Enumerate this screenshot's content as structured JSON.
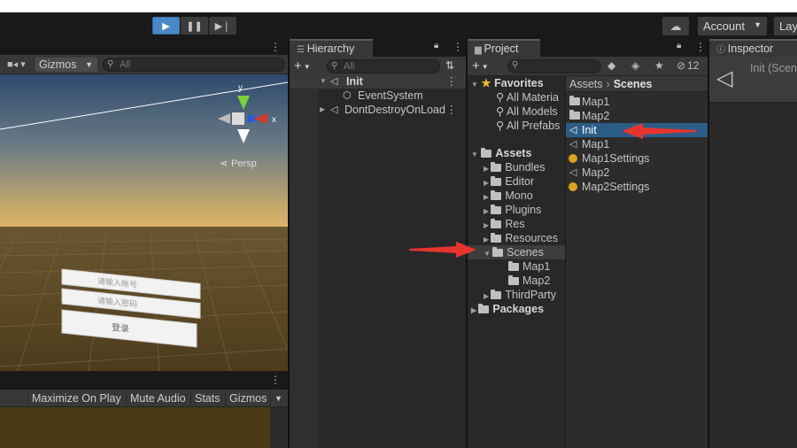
{
  "toolbar": {
    "account_label": "Account",
    "layout_label": "Lay"
  },
  "scene": {
    "gizmos_label": "Gizmos",
    "search_placeholder": "All",
    "persp_label": "Persp",
    "axis_y": "y",
    "axis_x": "x",
    "login_field_1": "请输入帐号",
    "login_field_2": "请输入密码",
    "login_button": "登录"
  },
  "game": {
    "maximize_label": "Maximize On Play",
    "mute_label": "Mute Audio",
    "stats_label": "Stats",
    "gizmos_label": "Gizmos"
  },
  "hierarchy": {
    "tab_label": "Hierarchy",
    "search_placeholder": "All",
    "items": [
      {
        "label": "Init"
      },
      {
        "label": "EventSystem"
      },
      {
        "label": "DontDestroyOnLoad"
      }
    ]
  },
  "project": {
    "tab_label": "Project",
    "hidden_count": "12",
    "favorites": {
      "label": "Favorites",
      "items": [
        "All Materia",
        "All Models",
        "All Prefabs"
      ]
    },
    "assets_label": "Assets",
    "folders": [
      "Bundles",
      "Editor",
      "Mono",
      "Plugins",
      "Res",
      "Resources",
      "Scenes",
      "ThirdParty"
    ],
    "scenes_children": [
      "Map1",
      "Map2"
    ],
    "packages_label": "Packages",
    "breadcrumb": {
      "root": "Assets",
      "current": "Scenes"
    },
    "files": [
      {
        "label": "Map1",
        "kind": "folder"
      },
      {
        "label": "Map2",
        "kind": "folder"
      },
      {
        "label": "Init",
        "kind": "scene"
      },
      {
        "label": "Map1",
        "kind": "scene"
      },
      {
        "label": "Map1Settings",
        "kind": "settings"
      },
      {
        "label": "Map2",
        "kind": "scene"
      },
      {
        "label": "Map2Settings",
        "kind": "settings"
      }
    ]
  },
  "inspector": {
    "tab_label": "Inspector",
    "title": "Init (Scen"
  },
  "colors": {
    "selection": "#2c5d87",
    "annotation_arrow": "#e8342e",
    "play_active": "#4a88c7"
  }
}
